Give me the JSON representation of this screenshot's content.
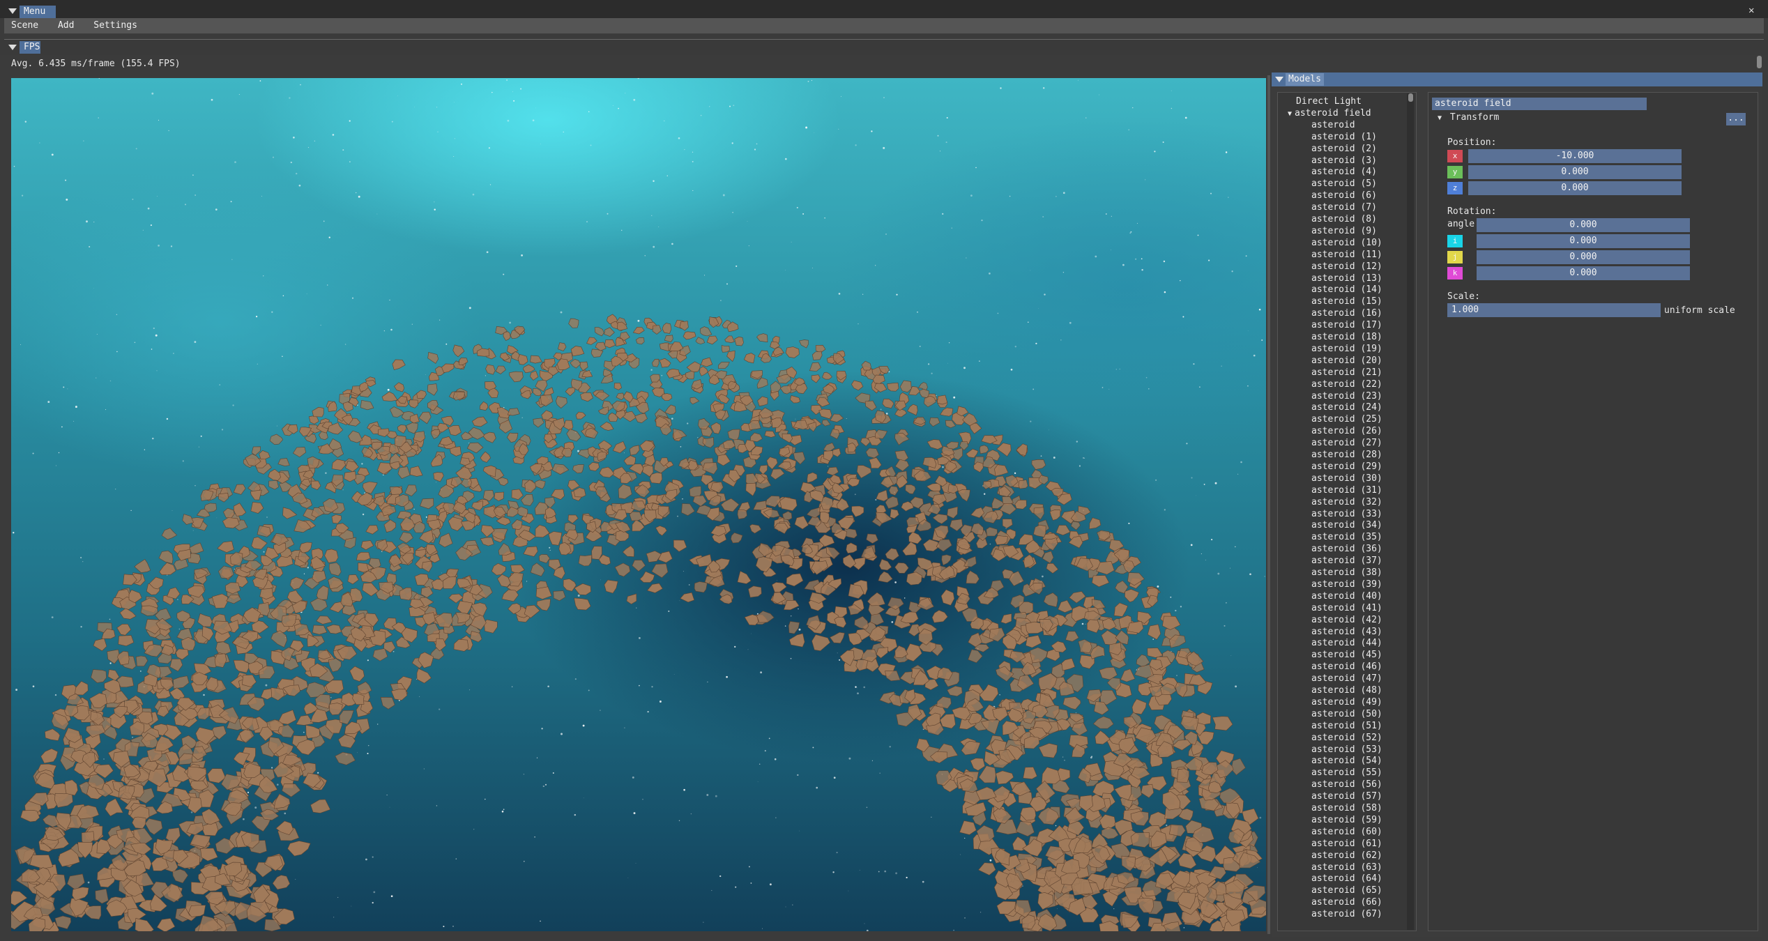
{
  "window": {
    "menu_tab": "Menu",
    "close_glyph": "✕"
  },
  "menubar": {
    "items": [
      "Scene",
      "Add",
      "Settings"
    ]
  },
  "fps": {
    "tab": "FPS",
    "text": "Avg. 6.435 ms/frame (155.4 FPS)"
  },
  "models": {
    "tab": "Models",
    "tree": {
      "top": [
        "Direct Light"
      ],
      "group": "asteroid field",
      "children": [
        "asteroid",
        "asteroid (1)",
        "asteroid (2)",
        "asteroid (3)",
        "asteroid (4)",
        "asteroid (5)",
        "asteroid (6)",
        "asteroid (7)",
        "asteroid (8)",
        "asteroid (9)",
        "asteroid (10)",
        "asteroid (11)",
        "asteroid (12)",
        "asteroid (13)",
        "asteroid (14)",
        "asteroid (15)",
        "asteroid (16)",
        "asteroid (17)",
        "asteroid (18)",
        "asteroid (19)",
        "asteroid (20)",
        "asteroid (21)",
        "asteroid (22)",
        "asteroid (23)",
        "asteroid (24)",
        "asteroid (25)",
        "asteroid (26)",
        "asteroid (27)",
        "asteroid (28)",
        "asteroid (29)",
        "asteroid (30)",
        "asteroid (31)",
        "asteroid (32)",
        "asteroid (33)",
        "asteroid (34)",
        "asteroid (35)",
        "asteroid (36)",
        "asteroid (37)",
        "asteroid (38)",
        "asteroid (39)",
        "asteroid (40)",
        "asteroid (41)",
        "asteroid (42)",
        "asteroid (43)",
        "asteroid (44)",
        "asteroid (45)",
        "asteroid (46)",
        "asteroid (47)",
        "asteroid (48)",
        "asteroid (49)",
        "asteroid (50)",
        "asteroid (51)",
        "asteroid (52)",
        "asteroid (53)",
        "asteroid (54)",
        "asteroid (55)",
        "asteroid (56)",
        "asteroid (57)",
        "asteroid (58)",
        "asteroid (59)",
        "asteroid (60)",
        "asteroid (61)",
        "asteroid (62)",
        "asteroid (63)",
        "asteroid (64)",
        "asteroid (65)",
        "asteroid (66)",
        "asteroid (67)"
      ]
    },
    "inspector": {
      "name_value": "asteroid field",
      "transform_header": "Transform",
      "more_button": "...",
      "position_label": "Position:",
      "position": [
        {
          "axis": "x",
          "value": "-10.000",
          "color": "#d04a55"
        },
        {
          "axis": "y",
          "value": "0.000",
          "color": "#6bbf5a"
        },
        {
          "axis": "z",
          "value": "0.000",
          "color": "#4f7fd8"
        }
      ],
      "rotation_label": "Rotation:",
      "angle_label": "angle",
      "angle_value": "0.000",
      "rotation": [
        {
          "axis": "i",
          "value": "0.000",
          "color": "#19d4e8"
        },
        {
          "axis": "j",
          "value": "0.000",
          "color": "#e2d84a"
        },
        {
          "axis": "k",
          "value": "0.000",
          "color": "#e04ad6"
        }
      ],
      "scale_label": "Scale:",
      "scale_value": "1.000",
      "uniform_label": "uniform scale"
    }
  },
  "colors": {
    "accent": "#4f6f9a",
    "field": "#5a7196",
    "asteroid": "#a07a5a"
  }
}
